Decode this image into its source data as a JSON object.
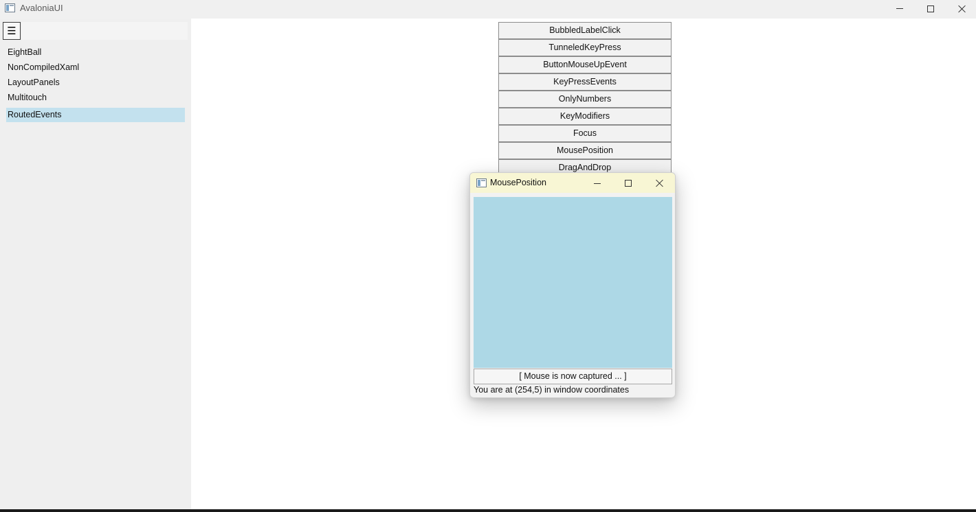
{
  "window": {
    "title": "AvaloniaUI",
    "controls": {
      "minimize": "minimize",
      "maximize": "maximize",
      "close": "close"
    }
  },
  "sidebar": {
    "menu_icon": "☰",
    "items": [
      {
        "label": "EightBall",
        "selected": false
      },
      {
        "label": "NonCompiledXaml",
        "selected": false
      },
      {
        "label": "LayoutPanels",
        "selected": false
      },
      {
        "label": "Multitouch",
        "selected": false
      },
      {
        "label": "RoutedEvents",
        "selected": true
      }
    ],
    "selected_color": "#c3e1ee"
  },
  "main": {
    "buttons": [
      "BubbledLabelClick",
      "TunneledKeyPress",
      "ButtonMouseUpEvent",
      "KeyPressEvents",
      "OnlyNumbers",
      "KeyModifiers",
      "Focus",
      "MousePosition",
      "DragAndDrop"
    ]
  },
  "dialog": {
    "title": "MousePosition",
    "titlebar_color": "#f8f6d4",
    "area_color": "#add8e6",
    "capture_button": "[ Mouse is now captured ... ]",
    "position_text": "You are at (254,5) in window coordinates"
  }
}
